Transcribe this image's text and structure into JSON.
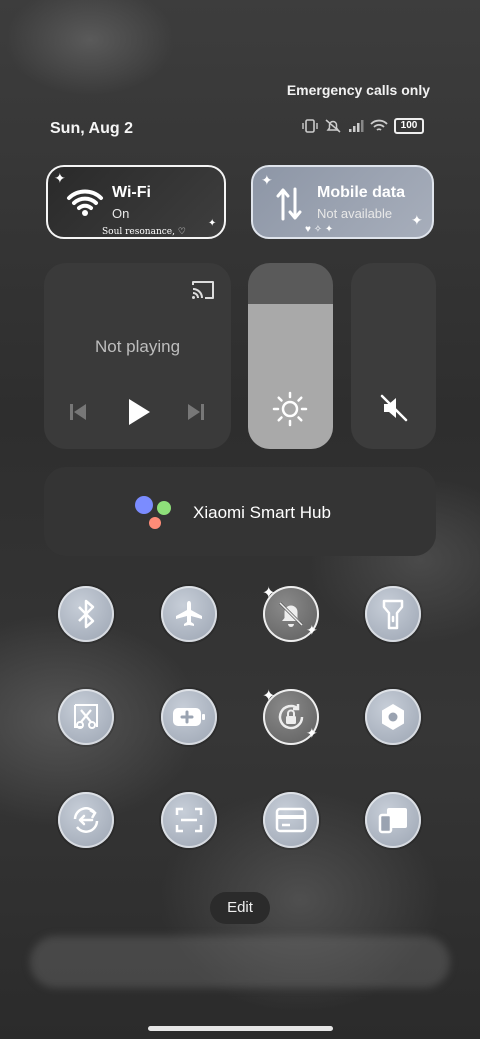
{
  "status": {
    "carrier_text": "Emergency calls only",
    "date": "Sun, Aug 2",
    "battery": "100"
  },
  "tiles": {
    "wifi": {
      "title": "Wi-Fi",
      "state": "On",
      "ribbon": "Soul resonance, ♡"
    },
    "mobile": {
      "title": "Mobile data",
      "state": "Not available"
    }
  },
  "media": {
    "status": "Not playing"
  },
  "brightness": {
    "level": 0.78
  },
  "hub": {
    "label": "Xiaomi Smart Hub"
  },
  "quick_toggles": [
    "bluetooth-icon",
    "airplane-icon",
    "bell-off-icon",
    "flashlight-icon",
    "scissors-icon",
    "battery-saver-icon",
    "rotation-lock-icon",
    "settings-hex-icon",
    "sync-icon",
    "scan-icon",
    "card-icon",
    "cast-device-icon"
  ],
  "edit": {
    "label": "Edit"
  },
  "colors": {
    "mobile_tile": "#9aa3b1",
    "hub_dot_blue": "#7b8cff",
    "hub_dot_green": "#8ee07a",
    "hub_dot_red": "#ff8c78"
  }
}
